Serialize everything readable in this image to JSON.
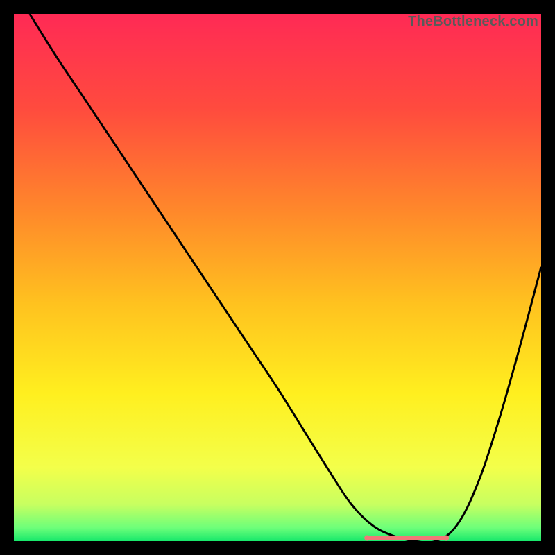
{
  "watermark": "TheBottleneck.com",
  "chart_data": {
    "type": "line",
    "title": "",
    "xlabel": "",
    "ylabel": "",
    "xlim": [
      0,
      100
    ],
    "ylim": [
      0,
      100
    ],
    "grid": false,
    "legend": false,
    "gradient_stops": [
      {
        "offset": 0.0,
        "color": "#ff2a55"
      },
      {
        "offset": 0.18,
        "color": "#ff4b3e"
      },
      {
        "offset": 0.38,
        "color": "#ff8a2a"
      },
      {
        "offset": 0.55,
        "color": "#ffc21f"
      },
      {
        "offset": 0.72,
        "color": "#ffef1f"
      },
      {
        "offset": 0.86,
        "color": "#f3ff4a"
      },
      {
        "offset": 0.93,
        "color": "#c8ff60"
      },
      {
        "offset": 0.975,
        "color": "#6cff7a"
      },
      {
        "offset": 1.0,
        "color": "#17e86b"
      }
    ],
    "series": [
      {
        "name": "bottleneck-curve",
        "color": "#000000",
        "x": [
          3,
          8,
          14,
          20,
          26,
          32,
          38,
          44,
          50,
          55,
          60,
          64,
          68,
          72,
          76,
          80,
          84,
          88,
          92,
          96,
          100
        ],
        "y": [
          100,
          92,
          83,
          74,
          65,
          56,
          47,
          38,
          29,
          21,
          13,
          7,
          3,
          1,
          0,
          0,
          3,
          11,
          23,
          37,
          52
        ]
      }
    ],
    "flat_segment": {
      "name": "optimal-range",
      "color": "#f07878",
      "x_start": 67,
      "x_end": 82,
      "y": 0.6,
      "endpoint_radius_px": 4,
      "thickness_px": 6
    }
  }
}
